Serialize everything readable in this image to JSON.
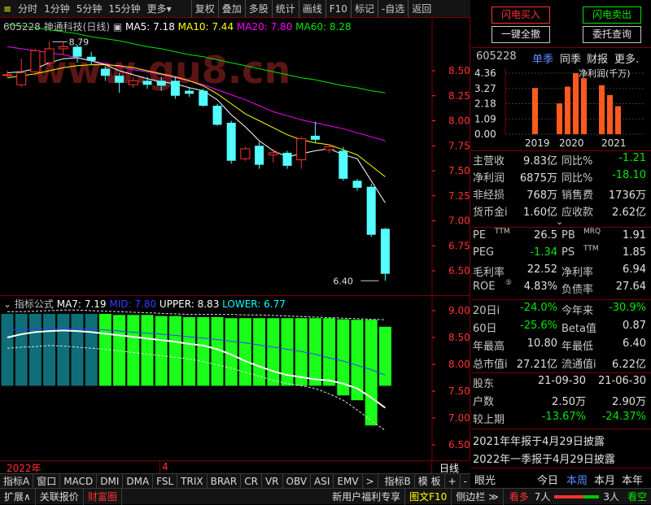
{
  "toolbar": {
    "items": [
      "分时",
      "1分钟",
      "5分钟",
      "15分钟",
      "更多"
    ],
    "dropdown_arrow": "▾",
    "tools": [
      "复权",
      "叠加",
      "多股",
      "统计",
      "画线",
      "F10",
      "标记",
      "-自选",
      "返回"
    ]
  },
  "chart": {
    "code": "605228",
    "name": "神通科技",
    "period": "(日线)",
    "ma": [
      {
        "label": "MA5:",
        "value": "7.18",
        "color": "#ffffff"
      },
      {
        "label": "MA10:",
        "value": "7.44",
        "color": "#ffff00"
      },
      {
        "label": "MA20:",
        "value": "7.80",
        "color": "#ff00ff"
      },
      {
        "label": "MA60:",
        "value": "8.28",
        "color": "#00e600"
      }
    ],
    "watermark": "www.gu8.cn",
    "high_label": "8.79",
    "low_label": "6.40",
    "price_axis": [
      "8.50",
      "8.25",
      "8.00",
      "7.75",
      "7.50",
      "7.25",
      "7.00",
      "6.75",
      "6.50"
    ],
    "colors": {
      "up": "#ff3232",
      "down": "#54ffff",
      "ma5": "#ffffff",
      "ma10": "#ffff00",
      "ma20": "#ff00ff",
      "ma60": "#00e600"
    }
  },
  "indicator": {
    "title": "指标公式",
    "params": [
      {
        "label": "MA7:",
        "value": "7.19",
        "color": "#ffffff"
      },
      {
        "label": "MID:",
        "value": "7.80",
        "color": "#3a3aff"
      },
      {
        "label": "UPPER:",
        "value": "8.83",
        "color": "#ffffff"
      },
      {
        "label": "LOWER:",
        "value": "6.77",
        "color": "#00ffff"
      }
    ],
    "axis": [
      "9.00",
      "8.50",
      "8.00",
      "7.50",
      "7.00",
      "6.50"
    ]
  },
  "chart_data": {
    "type": "candlestick",
    "price_range": [
      6.35,
      8.85
    ],
    "candles": [
      {
        "o": 8.46,
        "c": 8.46,
        "h": 8.5,
        "l": 8.44
      },
      {
        "o": 8.36,
        "c": 8.48,
        "h": 8.62,
        "l": 8.34
      },
      {
        "o": 8.49,
        "c": 8.7,
        "h": 8.72,
        "l": 8.45
      },
      {
        "o": 8.58,
        "c": 8.72,
        "h": 8.79,
        "l": 8.55
      },
      {
        "o": 8.72,
        "c": 8.74,
        "h": 8.79,
        "l": 8.66
      },
      {
        "o": 8.74,
        "c": 8.64,
        "h": 8.76,
        "l": 8.58
      },
      {
        "o": 8.64,
        "c": 8.6,
        "h": 8.69,
        "l": 8.56
      },
      {
        "o": 8.52,
        "c": 8.45,
        "h": 8.54,
        "l": 8.4
      },
      {
        "o": 8.45,
        "c": 8.38,
        "h": 8.48,
        "l": 8.28
      },
      {
        "o": 8.36,
        "c": 8.4,
        "h": 8.44,
        "l": 8.33
      },
      {
        "o": 8.4,
        "c": 8.36,
        "h": 8.44,
        "l": 8.32
      },
      {
        "o": 8.4,
        "c": 8.35,
        "h": 8.44,
        "l": 8.3
      },
      {
        "o": 8.4,
        "c": 8.25,
        "h": 8.44,
        "l": 8.22
      },
      {
        "o": 8.3,
        "c": 8.27,
        "h": 8.33,
        "l": 8.24
      },
      {
        "o": 8.3,
        "c": 8.15,
        "h": 8.32,
        "l": 8.14
      },
      {
        "o": 8.15,
        "c": 7.96,
        "h": 8.17,
        "l": 7.95
      },
      {
        "o": 7.98,
        "c": 7.6,
        "h": 8.0,
        "l": 7.57
      },
      {
        "o": 7.62,
        "c": 7.72,
        "h": 7.74,
        "l": 7.6
      },
      {
        "o": 7.75,
        "c": 7.56,
        "h": 7.79,
        "l": 7.52
      },
      {
        "o": 7.66,
        "c": 7.68,
        "h": 7.72,
        "l": 7.58
      },
      {
        "o": 7.68,
        "c": 7.55,
        "h": 7.7,
        "l": 7.52
      },
      {
        "o": 7.61,
        "c": 7.82,
        "h": 7.84,
        "l": 7.52
      },
      {
        "o": 7.85,
        "c": 7.81,
        "h": 7.99,
        "l": 7.78
      },
      {
        "o": 7.71,
        "c": 7.74,
        "h": 7.76,
        "l": 7.68
      },
      {
        "o": 7.7,
        "c": 7.42,
        "h": 7.74,
        "l": 7.4
      },
      {
        "o": 7.4,
        "c": 7.33,
        "h": 7.42,
        "l": 7.3
      },
      {
        "o": 7.34,
        "c": 6.86,
        "h": 7.37,
        "l": 6.84
      },
      {
        "o": 6.92,
        "c": 6.47,
        "h": 6.93,
        "l": 6.4
      }
    ],
    "ma5": [
      8.48,
      8.49,
      8.52,
      8.58,
      8.62,
      8.63,
      8.6,
      8.56,
      8.5,
      8.46,
      8.42,
      8.39,
      8.37,
      8.33,
      8.3,
      8.21,
      8.06,
      7.94,
      7.8,
      7.7,
      7.64,
      7.67,
      7.7,
      7.72,
      7.66,
      7.62,
      7.4,
      7.18
    ],
    "ma10": [
      8.43,
      8.45,
      8.47,
      8.5,
      8.53,
      8.55,
      8.56,
      8.56,
      8.55,
      8.53,
      8.5,
      8.47,
      8.44,
      8.4,
      8.35,
      8.27,
      8.17,
      8.07,
      8.0,
      7.93,
      7.86,
      7.81,
      7.78,
      7.76,
      7.71,
      7.66,
      7.55,
      7.44
    ],
    "ma20": [
      8.74,
      8.72,
      8.7,
      8.68,
      8.66,
      8.63,
      8.6,
      8.57,
      8.54,
      8.51,
      8.49,
      8.46,
      8.43,
      8.4,
      8.36,
      8.31,
      8.26,
      8.21,
      8.15,
      8.09,
      8.05,
      8.01,
      7.98,
      7.95,
      7.92,
      7.88,
      7.84,
      7.8
    ],
    "ma60": [
      8.96,
      8.95,
      8.93,
      8.91,
      8.89,
      8.87,
      8.84,
      8.82,
      8.8,
      8.77,
      8.74,
      8.72,
      8.69,
      8.66,
      8.64,
      8.61,
      8.58,
      8.55,
      8.52,
      8.49,
      8.46,
      8.43,
      8.41,
      8.38,
      8.35,
      8.33,
      8.3,
      8.28
    ],
    "indicator_range": [
      6.3,
      9.1
    ],
    "indicator_bars": [
      {
        "top": 8.94,
        "bot": 7.6,
        "color": "teal"
      },
      {
        "top": 8.94,
        "bot": 7.6,
        "color": "teal"
      },
      {
        "top": 8.94,
        "bot": 7.6,
        "color": "teal"
      },
      {
        "top": 8.94,
        "bot": 7.6,
        "color": "teal"
      },
      {
        "top": 8.94,
        "bot": 7.6,
        "color": "teal"
      },
      {
        "top": 8.94,
        "bot": 7.6,
        "color": "teal"
      },
      {
        "top": 8.94,
        "bot": 7.6,
        "color": "teal"
      },
      {
        "top": 8.94,
        "bot": 7.6,
        "color": "green"
      },
      {
        "top": 8.92,
        "bot": 7.6,
        "color": "green"
      },
      {
        "top": 8.92,
        "bot": 7.6,
        "color": "green"
      },
      {
        "top": 8.92,
        "bot": 7.6,
        "color": "green"
      },
      {
        "top": 8.9,
        "bot": 7.6,
        "color": "green"
      },
      {
        "top": 8.9,
        "bot": 7.6,
        "color": "green"
      },
      {
        "top": 8.88,
        "bot": 7.6,
        "color": "green"
      },
      {
        "top": 8.88,
        "bot": 7.6,
        "color": "green"
      },
      {
        "top": 8.88,
        "bot": 7.6,
        "color": "green"
      },
      {
        "top": 8.86,
        "bot": 7.6,
        "color": "green"
      },
      {
        "top": 8.86,
        "bot": 7.6,
        "color": "green"
      },
      {
        "top": 8.86,
        "bot": 7.6,
        "color": "green"
      },
      {
        "top": 8.86,
        "bot": 7.6,
        "color": "green"
      },
      {
        "top": 8.86,
        "bot": 7.6,
        "color": "green"
      },
      {
        "top": 8.86,
        "bot": 7.6,
        "color": "green"
      },
      {
        "top": 8.86,
        "bot": 7.6,
        "color": "green"
      },
      {
        "top": 8.86,
        "bot": 7.6,
        "color": "green"
      },
      {
        "top": 8.84,
        "bot": 7.42,
        "color": "green"
      },
      {
        "top": 8.83,
        "bot": 7.33,
        "color": "green"
      },
      {
        "top": 8.83,
        "bot": 6.86,
        "color": "green"
      },
      {
        "top": 8.7,
        "bot": 7.6,
        "color": "green"
      }
    ],
    "upper": [
      8.98,
      8.98,
      8.99,
      9.0,
      9.01,
      9.01,
      9.0,
      8.99,
      8.98,
      8.97,
      8.96,
      8.95,
      8.94,
      8.93,
      8.93,
      8.93,
      8.93,
      8.92,
      8.92,
      8.91,
      8.9,
      8.89,
      8.88,
      8.87,
      8.86,
      8.85,
      8.84,
      8.83
    ],
    "mid": [
      8.64,
      8.65,
      8.66,
      8.67,
      8.67,
      8.66,
      8.65,
      8.64,
      8.62,
      8.6,
      8.58,
      8.56,
      8.54,
      8.51,
      8.49,
      8.46,
      8.43,
      8.4,
      8.36,
      8.32,
      8.28,
      8.24,
      8.19,
      8.12,
      8.06,
      7.98,
      7.9,
      7.8
    ],
    "lower": [
      8.3,
      8.32,
      8.33,
      8.35,
      8.34,
      8.32,
      8.3,
      8.28,
      8.25,
      8.22,
      8.19,
      8.16,
      8.13,
      8.1,
      8.05,
      7.99,
      7.93,
      7.85,
      7.78,
      7.7,
      7.64,
      7.6,
      7.55,
      7.45,
      7.33,
      7.15,
      6.95,
      6.77
    ],
    "ma7": [
      8.5,
      8.56,
      8.6,
      8.62,
      8.63,
      8.62,
      8.6,
      8.57,
      8.54,
      8.51,
      8.48,
      8.45,
      8.42,
      8.38,
      8.35,
      8.28,
      8.18,
      8.06,
      7.96,
      7.87,
      7.8,
      7.76,
      7.72,
      7.7,
      7.64,
      7.55,
      7.38,
      7.19
    ]
  },
  "date_bar": {
    "year": "2022年",
    "month": "4",
    "period": "日线"
  },
  "bottom_tabs": [
    "指标A",
    "窗口",
    "MACD",
    "DMI",
    "DMA",
    "FSL",
    "TRIX",
    "BRAR",
    "CR",
    "VR",
    "OBV",
    "ASI",
    "EMV",
    ">",
    "指标B",
    "模 板",
    "+",
    "-"
  ],
  "status": {
    "left": [
      "扩展∧",
      "关联报价",
      "财富圈"
    ],
    "mid": [
      "新用户福利专享",
      "图文F10",
      "侧边栏 ≫"
    ],
    "right_label": "看多",
    "right_count": "7人",
    "right_count2": "3人",
    "right_label2": "看空"
  },
  "right": {
    "buttons": [
      "闪电买入",
      "闪电卖出",
      "一键全撤",
      "委托查询"
    ],
    "code": "605228",
    "tabs": [
      "单季",
      "同季",
      "财报",
      "更多."
    ],
    "mini_chart": {
      "y_ticks": [
        "4.36",
        "3.27",
        "2.18",
        "1.09",
        "0.00"
      ],
      "label": "净利润(千万)",
      "years": [
        "2019",
        "2020",
        "2021"
      ],
      "bars": [
        3.3,
        2.2,
        3.4,
        4.36,
        4.0,
        3.5,
        2.8,
        2.0
      ]
    },
    "fin1": [
      {
        "l1": "主营收",
        "v1": "9.83亿",
        "l2": "同比%",
        "v2": "-1.21"
      },
      {
        "l1": "净利润",
        "v1": "6875万",
        "l2": "同比%",
        "v2": "-18.10"
      },
      {
        "l1": "非经损",
        "v1": "768万",
        "l2": "销售费",
        "v2": "1736万"
      },
      {
        "l1": "货币金i",
        "v1": "1.60亿",
        "l2": "应收款",
        "v2": "2.62亿"
      }
    ],
    "fin2": [
      {
        "l1": "PE",
        "sup1": "TTM",
        "v1": "26.5",
        "l2": "PB",
        "sup2": "MRQ",
        "v2": "1.91"
      },
      {
        "l1": "PEG",
        "sup1": "",
        "v1": "-1.34",
        "l2": "PS",
        "sup2": "TTM",
        "v2": "1.85"
      },
      {
        "l1": "毛利率",
        "sup1": "",
        "v1": "22.52",
        "l2": "净利率",
        "sup2": "",
        "v2": "6.94"
      },
      {
        "l1": "ROE",
        "sup1": "⑤",
        "v1": "4.83%",
        "l2": "负债率",
        "sup2": "",
        "v2": "27.64"
      }
    ],
    "fin3": [
      {
        "l1": "20日i",
        "v1": "-24.0%",
        "l2": "今年来",
        "v2": "-30.9%"
      },
      {
        "l1": "60日",
        "v1": "-25.6%",
        "l2": "Beta值",
        "v2": "0.87"
      },
      {
        "l1": "年最高",
        "v1": "10.80",
        "l2": "年最低",
        "v2": "6.40"
      },
      {
        "l1": "总市值i",
        "v1": "27.21亿",
        "l2": "流通值i",
        "v2": "6.22亿"
      }
    ],
    "holders": [
      {
        "l": "股东",
        "v1": "21-09-30",
        "v2": "21-06-30"
      },
      {
        "l": "户数",
        "v1": "2.50万",
        "v2": "2.90万"
      },
      {
        "l": "较上期",
        "v1": "-13.67%",
        "v2": "-24.37%"
      }
    ],
    "notices": [
      "2021年年报于4月29日披露",
      "2022年一季报于4月29日披露"
    ],
    "range_tabs": {
      "label": "眼光",
      "items": [
        "今日",
        "本周",
        "本月",
        "本年"
      ]
    }
  }
}
